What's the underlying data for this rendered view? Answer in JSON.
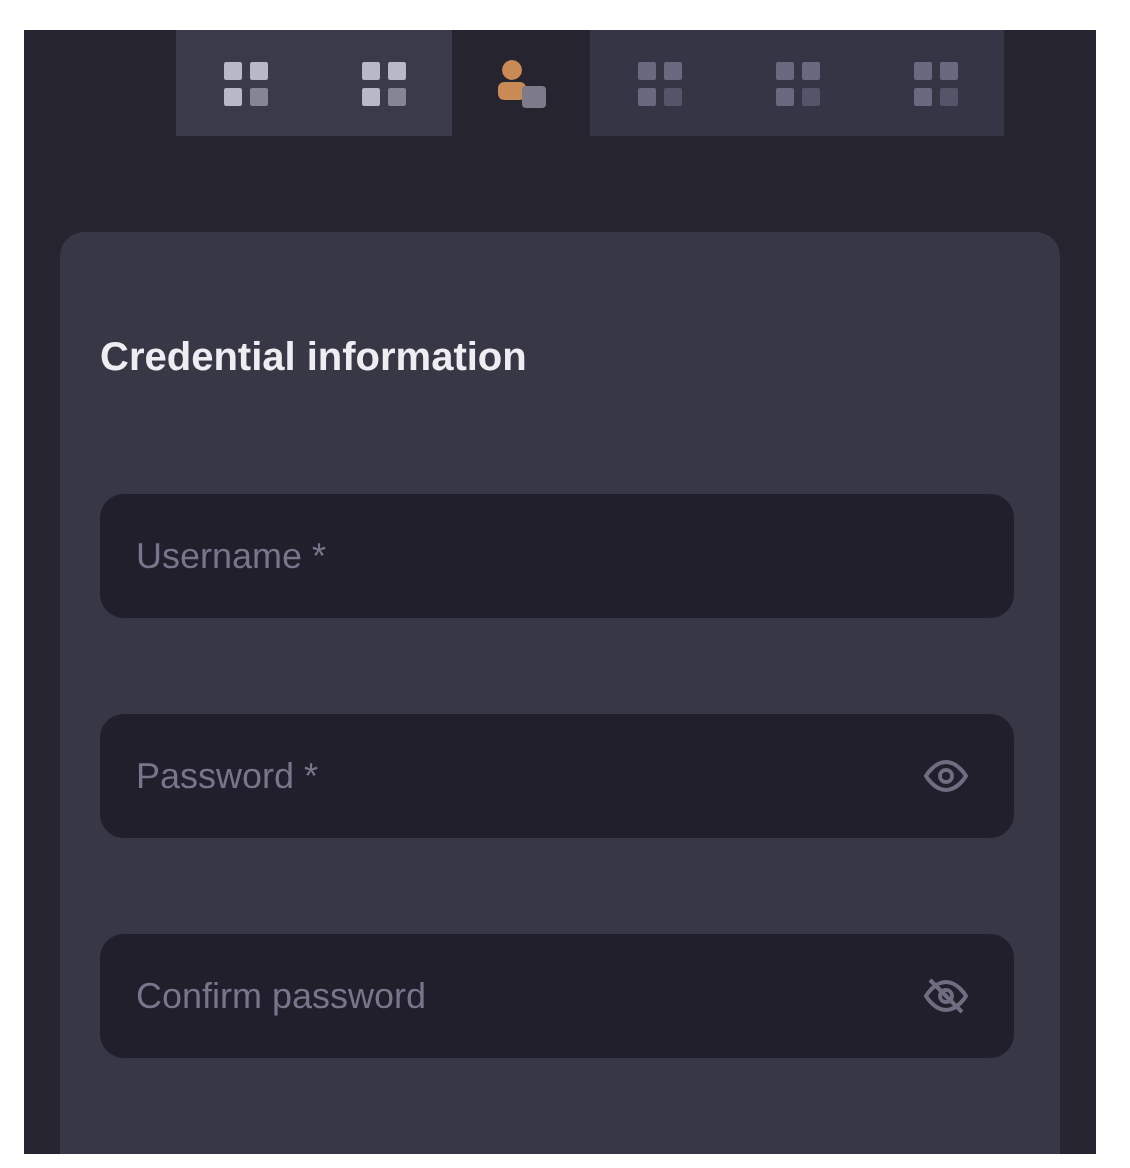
{
  "steps": [
    {
      "kind": "done",
      "selected": false
    },
    {
      "kind": "done",
      "selected": false
    },
    {
      "kind": "person",
      "selected": true
    },
    {
      "kind": "pending",
      "selected": false
    },
    {
      "kind": "pending",
      "selected": false
    },
    {
      "kind": "pending",
      "selected": false
    }
  ],
  "form": {
    "title": "Credential information",
    "fields": [
      {
        "placeholder": "Username *",
        "kind": "plain"
      },
      {
        "placeholder": "Password *",
        "kind": "reveal"
      },
      {
        "placeholder": "Confirm password",
        "kind": "masked"
      }
    ]
  }
}
